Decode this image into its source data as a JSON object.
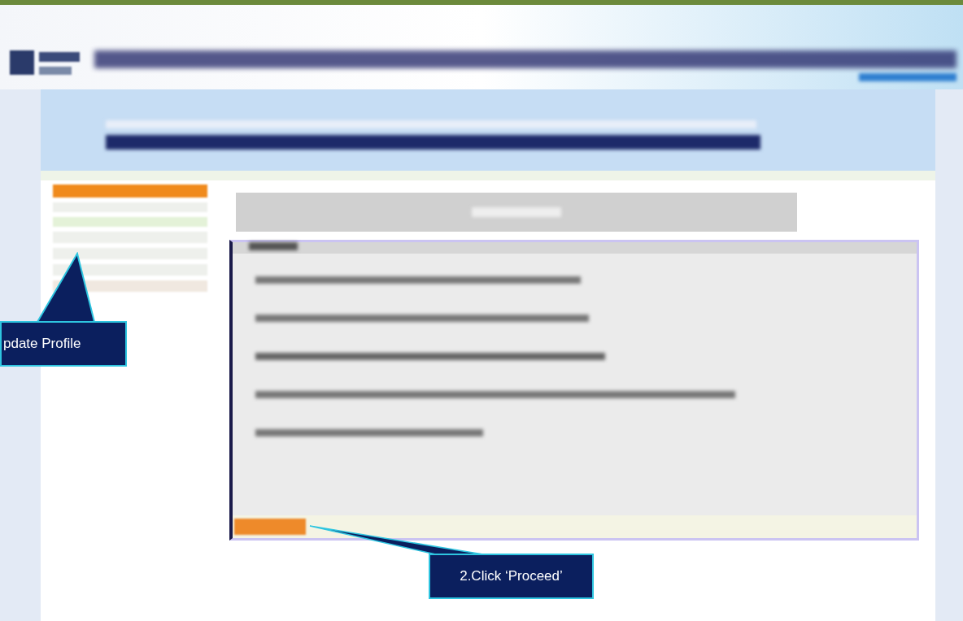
{
  "callouts": [
    {
      "text": "pdate Profile",
      "kind": "up"
    },
    {
      "text": "2.Click ‘Proceed’",
      "kind": "left"
    }
  ]
}
